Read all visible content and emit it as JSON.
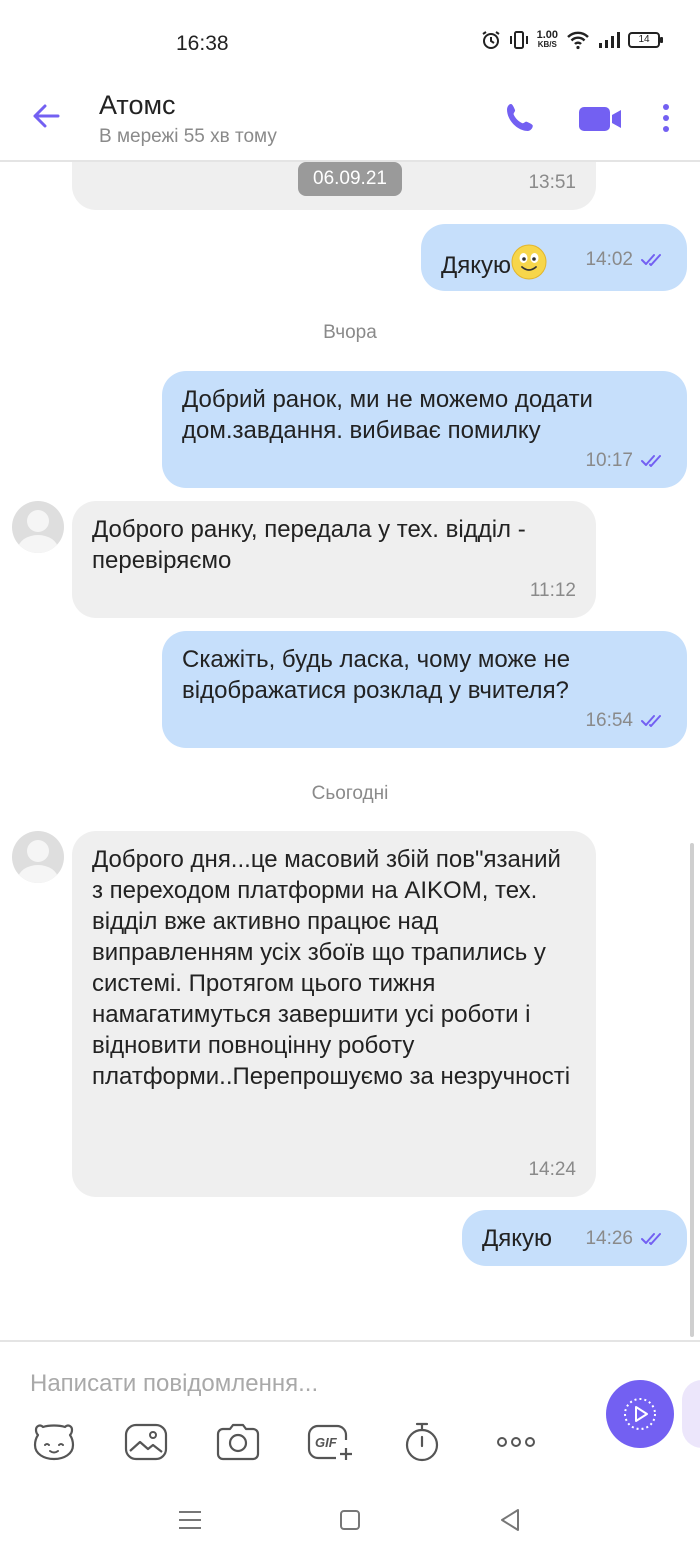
{
  "status_bar": {
    "time": "16:38",
    "net_speed": "1.00",
    "net_unit": "KB/S",
    "battery": "14"
  },
  "header": {
    "name": "Атомс",
    "status": "В мережі 55 хв тому"
  },
  "floating_date": "06.09.21",
  "messages": [
    {
      "dir": "in",
      "text": "",
      "time": "13:51"
    },
    {
      "dir": "out",
      "text": "Дякую",
      "time": "14:02",
      "emoji": "smiley"
    },
    {
      "dir": "out",
      "text": "Добрий ранок, ми не можемо додати дом.завдання. вибиває помилку",
      "time": "10:17"
    },
    {
      "dir": "in",
      "text": "Доброго ранку, передала у тех. відділ - перевіряємо",
      "time": "11:12"
    },
    {
      "dir": "out",
      "text": "Скажіть, будь ласка, чому може не відображатися розклад у вчителя?",
      "time": "16:54"
    },
    {
      "dir": "in",
      "text": "Доброго дня...це масовий збій пов\"язаний з переходом платформи на AIKOM, тех. відділ вже активно працює над виправленням усіх збоїв що трапились у системі. Протягом цього тижня намагатимуться завершити усі роботи і відновити повноцінну роботу платформи..Перепрошуємо за незручності",
      "time": "14:24"
    },
    {
      "dir": "out",
      "text": "Дякую",
      "time": "14:26"
    }
  ],
  "date_separators": {
    "yesterday": "Вчора",
    "today": "Сьогодні"
  },
  "composer": {
    "placeholder": "Написати повідомлення...",
    "gif_label": "GIF"
  },
  "colors": {
    "accent": "#7360f2",
    "outgoing_bubble": "#c6dffb",
    "incoming_bubble": "#efefef"
  },
  "icons": [
    "back-arrow-icon",
    "phone-icon",
    "video-camera-icon",
    "more-vertical-icon",
    "sticker-icon",
    "gallery-icon",
    "camera-icon",
    "gif-icon",
    "timer-icon",
    "more-horizontal-icon",
    "send-voice-icon"
  ]
}
